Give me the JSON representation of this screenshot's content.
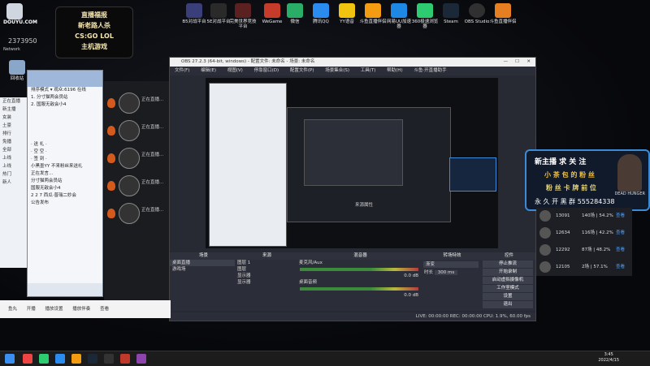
{
  "desktop": {
    "icons": [
      {
        "label": "B5对战平台",
        "color": "#3a3f7a"
      },
      {
        "label": "5E对战平台",
        "color": "#2a2a2a"
      },
      {
        "label": "完美世界竞技平台",
        "color": "#5b2020"
      },
      {
        "label": "WeGame",
        "color": "#c63b2a"
      },
      {
        "label": "微信",
        "color": "#2aae67"
      },
      {
        "label": "腾讯QQ",
        "color": "#2b8cf0"
      },
      {
        "label": "YY语音",
        "color": "#f1c40f"
      },
      {
        "label": "斗鱼直播伴侣",
        "color": "#f39c12"
      },
      {
        "label": "网易UU加速器",
        "color": "#1e88e5"
      },
      {
        "label": "360极速浏览器",
        "color": "#2ecc71"
      },
      {
        "label": "Steam",
        "color": "#1b2838"
      },
      {
        "label": "OBS Studio",
        "color": "#303030"
      },
      {
        "label": "斗鱼直播伴侣",
        "color": "#e67e22"
      }
    ],
    "recycle_bin_label": "回收站",
    "network_label": "Network",
    "douyu_logo_text": "DOUYU.COM",
    "room_id": "2373950",
    "banner_lines": [
      "直播福报",
      "新老路人杀",
      "CS:GO LOL",
      "主机游戏"
    ]
  },
  "chat_window": {
    "lines": [
      "排序模式 ▾ 观众:6196 在线",
      "1. 分寸猫两会员站",
      "2. 国服无敌会小4",
      "· 送 礼 ·",
      "· 空 空 ·",
      "· 签 到 ·",
      "小黑墨YY 不来粉丝来送礼",
      "正在发言...",
      "分寸猫两会员站",
      "国服无敌会小4",
      "2 2 7 西瓜·普瑞二妙会",
      "公告发布"
    ],
    "user_avatar_label": "主播"
  },
  "left_list": {
    "rows": [
      "正在直播",
      "新主播",
      "女装",
      "土豪",
      "排行",
      "免播",
      "全部",
      "上线",
      "上线",
      "热门",
      "新人"
    ]
  },
  "user_panel": {
    "rows": [
      "正在直播...",
      "正在直播...",
      "正在直播...",
      "正在直播...",
      "正在直播..."
    ]
  },
  "obs": {
    "title": "OBS 27.2.3 (64-bit, windows) - 配置文件: 未命名 - 场景: 未命名",
    "menu": [
      "文件(F)",
      "编辑(E)",
      "视图(V)",
      "停靠窗口(D)",
      "配置文件(P)",
      "场景集合(S)",
      "工具(T)",
      "帮助(H)",
      "斗鱼·开直播助手"
    ],
    "docks": {
      "scenes": {
        "title": "场景",
        "items": [
          "桌面直播",
          "游戏场"
        ]
      },
      "sources": {
        "title": "来源",
        "items": [
          "图层 1",
          "图层",
          "显示器",
          "显示器"
        ]
      },
      "mixer": {
        "title": "混音器",
        "channels": [
          "麦克风/Aux",
          "桌面音频"
        ],
        "levels": [
          "0.0 dB",
          "0.0 dB"
        ]
      },
      "transitions": {
        "title": "转场特效",
        "type": "渐变",
        "duration_label": "时长",
        "duration": "300 ms"
      },
      "controls": {
        "title": "控件",
        "buttons": [
          "停止推流",
          "开始录制",
          "启动虚拟摄像机",
          "工作室模式",
          "设置",
          "退出"
        ]
      }
    },
    "preview_label": "来源属性",
    "status": "LIVE: 00:00:00   REC: 00:00:00   CPU: 1.9%, 60.00 fps"
  },
  "streamer_card": {
    "line1": "新主播 求 关 注",
    "line2": "小 茶 包 的 粉 丝",
    "line3": "粉 丝 卡 牌 前 位",
    "line4": "永 久 开 黑 群 555284338",
    "tag": "DEAD HUNGER"
  },
  "rank_list": {
    "rows": [
      {
        "id": "13091",
        "pct": "140场 | 54.2%",
        "link": "查看"
      },
      {
        "id": "12634",
        "pct": "116场 | 42.2%",
        "link": "查看"
      },
      {
        "id": "12292",
        "pct": "87场 | 48.2%",
        "link": "查看"
      },
      {
        "id": "12105",
        "pct": "2场 | 57.1%",
        "link": "查看"
      }
    ]
  },
  "douyu_bar": {
    "items": [
      "鱼丸",
      "开播",
      "播放设置",
      "播放伴奏",
      "查看"
    ]
  },
  "taskbar": {
    "time": "3:45",
    "date": "2022/4/15"
  }
}
